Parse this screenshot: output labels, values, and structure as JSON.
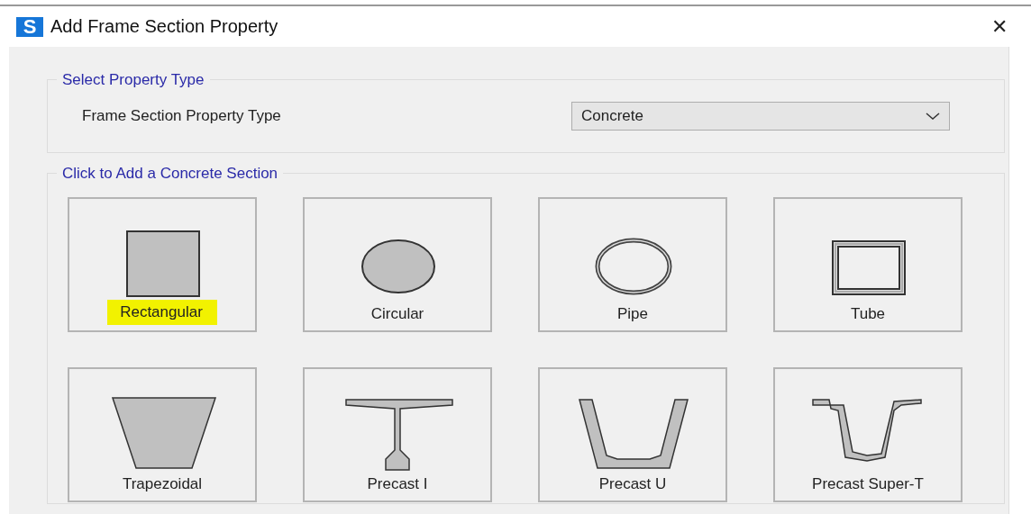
{
  "window": {
    "logo": "S",
    "title": "Add Frame Section Property",
    "close": "✕"
  },
  "property_type": {
    "legend": "Select Property Type",
    "label": "Frame Section Property Type",
    "value": "Concrete"
  },
  "sections": {
    "legend": "Click to Add a Concrete Section",
    "items": [
      {
        "label": "Rectangular",
        "kind": "rectangle",
        "highlighted": true
      },
      {
        "label": "Circular",
        "kind": "circle",
        "highlighted": false
      },
      {
        "label": "Pipe",
        "kind": "pipe",
        "highlighted": false
      },
      {
        "label": "Tube",
        "kind": "tube",
        "highlighted": false
      },
      {
        "label": "Trapezoidal",
        "kind": "trapezoid",
        "highlighted": false
      },
      {
        "label": "Precast I",
        "kind": "precasti",
        "highlighted": false
      },
      {
        "label": "Precast U",
        "kind": "precastu",
        "highlighted": false
      },
      {
        "label": "Precast Super-T",
        "kind": "supert",
        "highlighted": false
      }
    ]
  }
}
